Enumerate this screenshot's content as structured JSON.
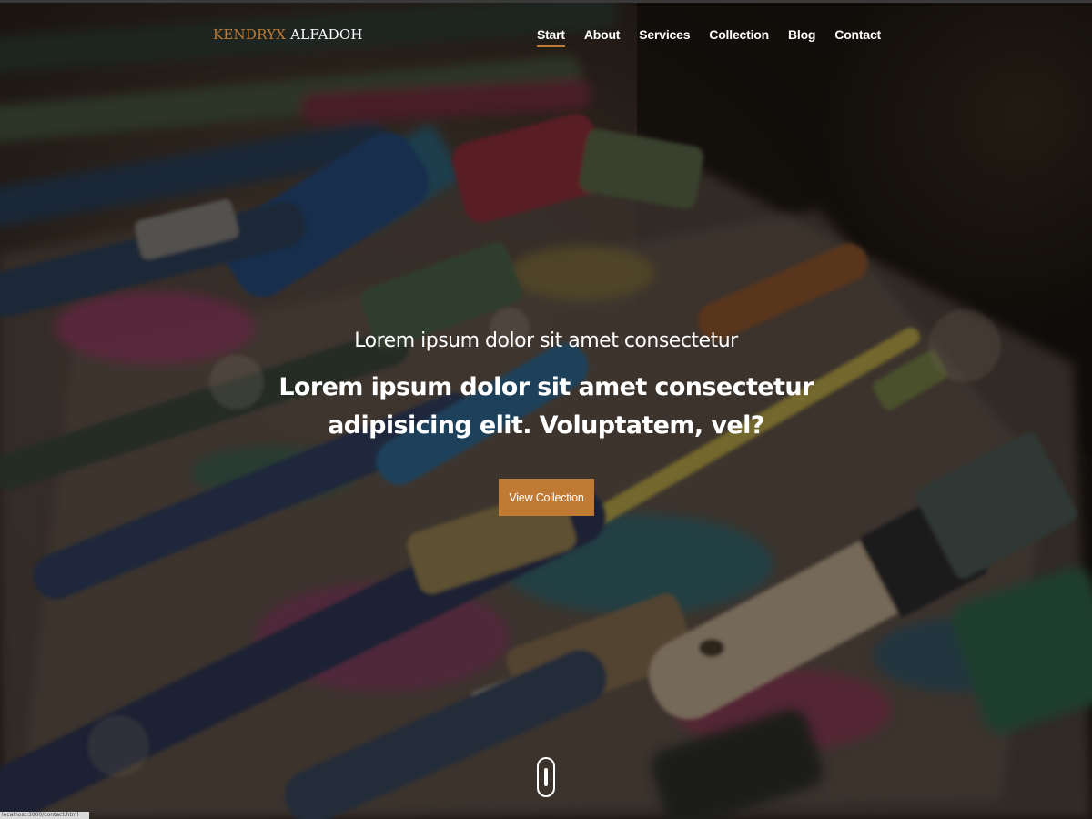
{
  "brand": {
    "first": "KENDRYX",
    "last": "ALFADOH"
  },
  "nav": {
    "items": [
      {
        "label": "Start",
        "active": true
      },
      {
        "label": "About",
        "active": false
      },
      {
        "label": "Services",
        "active": false
      },
      {
        "label": "Collection",
        "active": false
      },
      {
        "label": "Blog",
        "active": false
      },
      {
        "label": "Contact",
        "active": false
      }
    ]
  },
  "hero": {
    "kicker": "Lorem ipsum dolor sit amet consectetur",
    "headline": "Lorem ipsum dolor sit amet consectetur adipisicing elit. Voluptatem, vel?",
    "cta_label": "View Collection",
    "background_icon": "paint-brushes-photo",
    "scroll_icon": "mouse-scroll-icon"
  },
  "status_bar": {
    "url": "localhost:3000/contact.html"
  },
  "colors": {
    "accent": "#c07a34",
    "text": "#ffffff"
  }
}
